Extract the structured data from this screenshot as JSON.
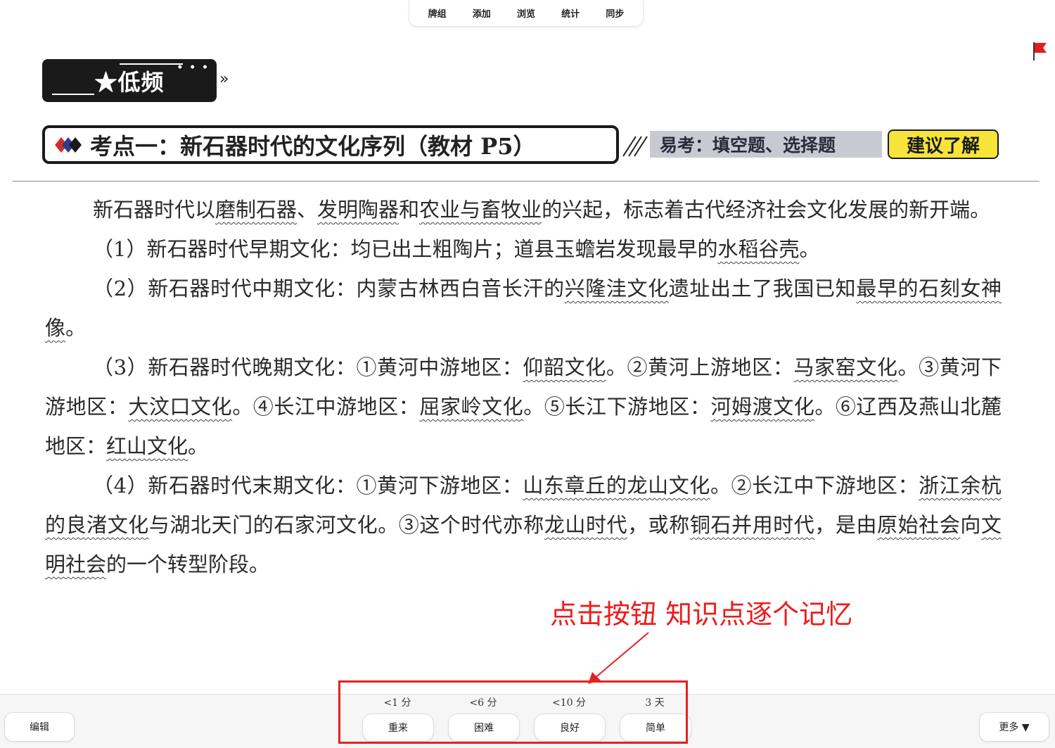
{
  "topnav": {
    "items": [
      "牌组",
      "添加",
      "浏览",
      "统计",
      "同步"
    ]
  },
  "header": {
    "badge": "★低频",
    "chevron": "»",
    "topic_title": "考点一：新石器时代的文化序列（教材 P5）",
    "easy_text": "易考：填空题、选择题",
    "suggest_text": "建议了解"
  },
  "content": {
    "p1": [
      "新石器时代以",
      "磨制石器",
      "、",
      "发明陶器",
      "和",
      "农业与畜牧业",
      "的兴起，标志着古代经济社会文化发展的新开端。"
    ],
    "p2": [
      "（1）新石器时代早期文化：均已出土粗陶片；道县玉蟾岩发现最早的",
      "水稻谷壳",
      "。"
    ],
    "p3": [
      "（2）新石器时代中期文化：内蒙古林西白音长汗的",
      "兴隆洼文化",
      "遗址出土了我国已知",
      "最早的石刻女神像",
      "。"
    ],
    "p4": [
      "（3）新石器时代晚期文化：①黄河中游地区：",
      "仰韶文化",
      "。②黄河上游地区：",
      "马家窑文化",
      "。③黄河下游地区：",
      "大汶口文化",
      "。④长江中游地区：",
      "屈家岭文化",
      "。⑤长江下游地区：",
      "河姆渡文化",
      "。⑥辽西及燕山北麓地区：",
      "红山文化",
      "。"
    ],
    "p5": [
      "（4）新石器时代末期文化：①黄河下游地区：",
      "山东章丘的龙山文化",
      "。②长江中下游地区：",
      "浙江余杭的良渚文化",
      "与湖北天门的石家河文化。③这个时代亦称",
      "龙山时代",
      "，或称",
      "铜石并用时代",
      "，是由",
      "原始社会",
      "向",
      "文明社会",
      "的一个转型阶段。"
    ]
  },
  "annotation": "点击按钮 知识点逐个记忆",
  "bottom": {
    "edit_label": "编辑",
    "more_label": "更多 ▼",
    "answers": [
      {
        "time": "<1 分",
        "label": "重来"
      },
      {
        "time": "<6 分",
        "label": "困难"
      },
      {
        "time": "<10 分",
        "label": "良好"
      },
      {
        "time": "3 天",
        "label": "简单"
      }
    ]
  },
  "colors": {
    "accent_red": "#e42222",
    "flag_red": "#e31c1c",
    "suggest_yellow": "#f7e43a",
    "easy_gray": "#c9c9d2"
  },
  "icons": [
    "flag-icon",
    "chevron-right-icon",
    "diamond-mark-icon",
    "hatch-icon",
    "arrow-icon"
  ]
}
